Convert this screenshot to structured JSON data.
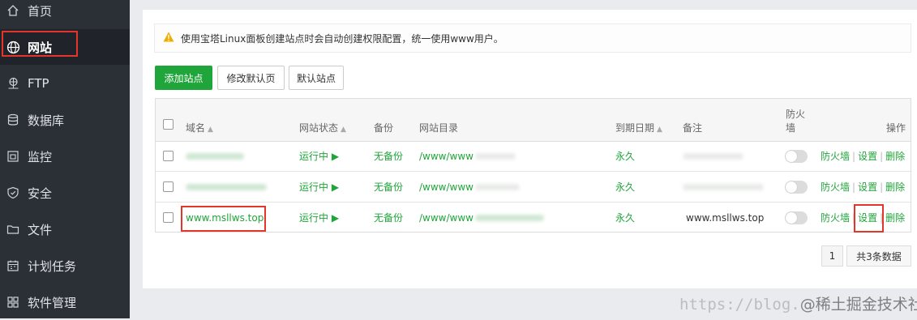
{
  "sidebar": {
    "items": [
      {
        "label": "首页",
        "icon": "home-icon"
      },
      {
        "label": "网站",
        "icon": "globe-icon",
        "active": true
      },
      {
        "label": "FTP",
        "icon": "network-icon"
      },
      {
        "label": "数据库",
        "icon": "database-icon"
      },
      {
        "label": "监控",
        "icon": "monitor-icon"
      },
      {
        "label": "安全",
        "icon": "shield-icon"
      },
      {
        "label": "文件",
        "icon": "folder-icon"
      },
      {
        "label": "计划任务",
        "icon": "calendar-icon"
      },
      {
        "label": "软件管理",
        "icon": "apps-icon"
      }
    ]
  },
  "notice": {
    "text": "使用宝塔Linux面板创建站点时会自动创建权限配置，统一使用www用户。",
    "icon": "warning-icon"
  },
  "toolbar": {
    "add_site": "添加站点",
    "edit_default_page": "修改默认页",
    "default_site": "默认站点"
  },
  "table": {
    "headers": {
      "domain": "域名",
      "status": "网站状态",
      "backup": "备份",
      "directory": "网站目录",
      "expiry": "到期日期",
      "note": "备注",
      "firewall_line1": "防火",
      "firewall_line2": "墙",
      "actions": "操作"
    },
    "rows": [
      {
        "domain": "",
        "status": "运行中 ▶",
        "backup": "无备份",
        "directory": "/www/www",
        "expiry": "永久",
        "note": "",
        "ops": {
          "firewall": "防火墙",
          "settings": "设置",
          "delete": "删除"
        }
      },
      {
        "domain": "",
        "status": "运行中 ▶",
        "backup": "无备份",
        "directory": "/www/www",
        "expiry": "永久",
        "note": "",
        "ops": {
          "firewall": "防火墙",
          "settings": "设置",
          "delete": "删除"
        }
      },
      {
        "domain": "www.msllws.top",
        "status": "运行中 ▶",
        "backup": "无备份",
        "directory": "/www/www",
        "expiry": "永久",
        "note": "www.msllws.top",
        "ops": {
          "firewall": "防火墙",
          "settings": "设置",
          "delete": "删除"
        }
      }
    ]
  },
  "pagination": {
    "page": "1",
    "total": "共3条数据"
  },
  "watermark": {
    "url": "https://blog.",
    "text": "@稀土掘金技术社区"
  },
  "colors": {
    "sidebar_bg": "#2b3036",
    "accent_green": "#20a53a",
    "highlight_red": "#e3352a"
  }
}
